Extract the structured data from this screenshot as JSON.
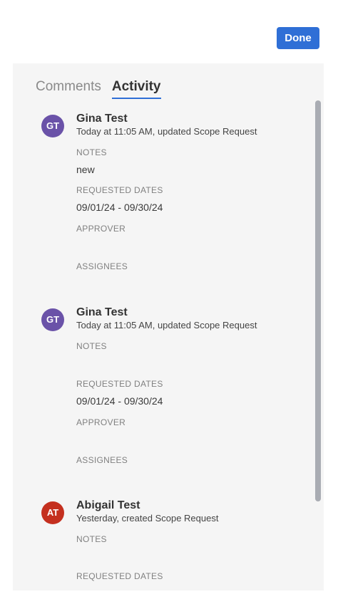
{
  "header": {
    "done_label": "Done"
  },
  "tabs": [
    {
      "label": "Comments",
      "active": false
    },
    {
      "label": "Activity",
      "active": true
    }
  ],
  "colors": {
    "accent": "#2f6fd6",
    "avatar_gt": "#6a52a8",
    "avatar_at": "#c4301f"
  },
  "activity": [
    {
      "initials": "GT",
      "name": "Gina Test",
      "summary": "Today at 11:05 AM, updated Scope Request",
      "notes_label": "NOTES",
      "notes_value": "new",
      "dates_label": "REQUESTED DATES",
      "dates_value": "09/01/24 - 09/30/24",
      "approver_label": "APPROVER",
      "assignees_label": "ASSIGNEES"
    },
    {
      "initials": "GT",
      "name": "Gina Test",
      "summary": "Today at 11:05 AM, updated Scope Request",
      "notes_label": "NOTES",
      "dates_label": "REQUESTED DATES",
      "dates_value": "09/01/24 - 09/30/24",
      "approver_label": "APPROVER",
      "assignees_label": "ASSIGNEES"
    },
    {
      "initials": "AT",
      "name": "Abigail Test",
      "summary": "Yesterday, created Scope Request",
      "notes_label": "NOTES",
      "dates_label": "REQUESTED DATES"
    }
  ]
}
